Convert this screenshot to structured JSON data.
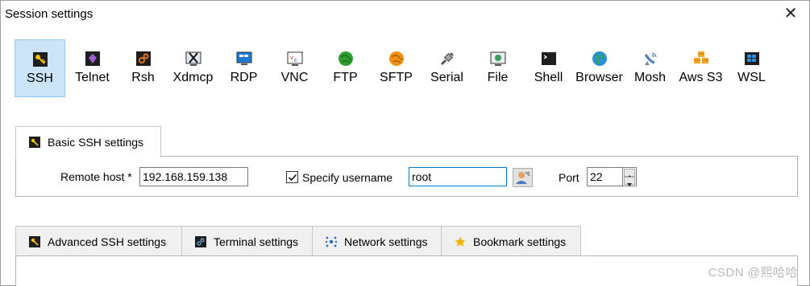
{
  "window": {
    "title": "Session settings",
    "close_glyph": "✕"
  },
  "protocols": [
    {
      "label": "SSH",
      "icon": "key-icon",
      "active": true
    },
    {
      "label": "Telnet",
      "icon": "telnet-icon"
    },
    {
      "label": "Rsh",
      "icon": "rsh-icon"
    },
    {
      "label": "Xdmcp",
      "icon": "x-display-icon"
    },
    {
      "label": "RDP",
      "icon": "remote-desktop-icon"
    },
    {
      "label": "VNC",
      "icon": "vnc-icon"
    },
    {
      "label": "FTP",
      "icon": "globe-green-icon"
    },
    {
      "label": "SFTP",
      "icon": "globe-orange-icon"
    },
    {
      "label": "Serial",
      "icon": "serial-plug-icon"
    },
    {
      "label": "File",
      "icon": "file-monitor-icon"
    },
    {
      "label": "Shell",
      "icon": "terminal-icon"
    },
    {
      "label": "Browser",
      "icon": "globe-blue-icon"
    },
    {
      "label": "Mosh",
      "icon": "satellite-icon"
    },
    {
      "label": "Aws S3",
      "icon": "aws-cubes-icon"
    },
    {
      "label": "WSL",
      "icon": "windows-icon"
    }
  ],
  "basic_tab": {
    "label": "Basic SSH settings",
    "icon": "key-icon"
  },
  "basic": {
    "remote_host_label": "Remote host *",
    "remote_host_value": "192.168.159.138",
    "specify_username_label": "Specify username",
    "specify_username_checked": true,
    "username_value": "root",
    "port_label": "Port",
    "port_value": "22"
  },
  "lower_tabs": [
    {
      "label": "Advanced SSH settings",
      "icon": "key-icon"
    },
    {
      "label": "Terminal settings",
      "icon": "terminal-settings-icon"
    },
    {
      "label": "Network settings",
      "icon": "network-icon"
    },
    {
      "label": "Bookmark settings",
      "icon": "star-icon"
    }
  ],
  "watermark": "CSDN @熙哈哈",
  "colors": {
    "active_bg": "#cce4f7",
    "active_border": "#99c9ef",
    "focus_border": "#0078d7"
  }
}
